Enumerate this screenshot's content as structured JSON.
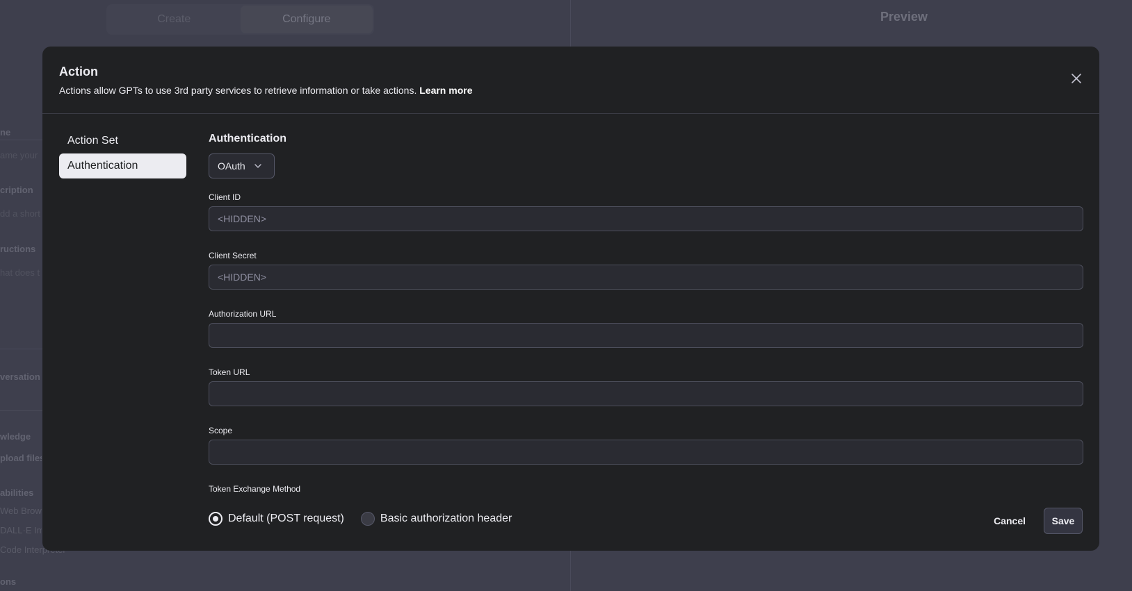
{
  "background": {
    "tabs": [
      {
        "label": "Create"
      },
      {
        "label": "Configure"
      }
    ],
    "preview_title": "Preview",
    "left_fragments": [
      {
        "text": "ne",
        "kind": "label"
      },
      {
        "text": "ame your",
        "kind": "hint"
      },
      {
        "text": "cription",
        "kind": "label"
      },
      {
        "text": "dd a short",
        "kind": "hint"
      },
      {
        "text": "ructions",
        "kind": "label"
      },
      {
        "text": "hat does t",
        "kind": "hint"
      },
      {
        "text": "versation",
        "kind": "label"
      },
      {
        "text": "wledge",
        "kind": "label"
      },
      {
        "text": "pload files",
        "kind": "hint"
      },
      {
        "text": "abilities",
        "kind": "label"
      },
      {
        "text": "Web Brow",
        "kind": "hint"
      },
      {
        "text": "DALL·E Im",
        "kind": "hint"
      },
      {
        "text": "Code Interpreter",
        "kind": "hint"
      },
      {
        "text": "ons",
        "kind": "label"
      }
    ]
  },
  "modal": {
    "title": "Action",
    "description": "Actions allow GPTs to use 3rd party services to retrieve information or take actions.",
    "learn_more": "Learn more",
    "nav": [
      {
        "label": "Action Set",
        "active": false
      },
      {
        "label": "Authentication",
        "active": true
      }
    ],
    "section_title": "Authentication",
    "auth_type": "OAuth",
    "fields": {
      "client_id": {
        "label": "Client ID",
        "placeholder": "<HIDDEN>",
        "value": ""
      },
      "client_secret": {
        "label": "Client Secret",
        "placeholder": "<HIDDEN>",
        "value": ""
      },
      "authorization_url": {
        "label": "Authorization URL",
        "placeholder": "",
        "value": ""
      },
      "token_url": {
        "label": "Token URL",
        "placeholder": "",
        "value": ""
      },
      "scope": {
        "label": "Scope",
        "placeholder": "",
        "value": ""
      }
    },
    "token_exchange": {
      "label": "Token Exchange Method",
      "options": [
        {
          "label": "Default (POST request)",
          "checked": true
        },
        {
          "label": "Basic authorization header",
          "checked": false
        }
      ]
    },
    "buttons": {
      "cancel": "Cancel",
      "save": "Save"
    }
  },
  "icons": {
    "close": "close-icon",
    "dropdown": "chevron-down-icon"
  },
  "colors": {
    "modal_bg": "#202123",
    "backdrop": "#444654",
    "active_nav": "#ececf1",
    "input_bg": "#2a2b32"
  }
}
